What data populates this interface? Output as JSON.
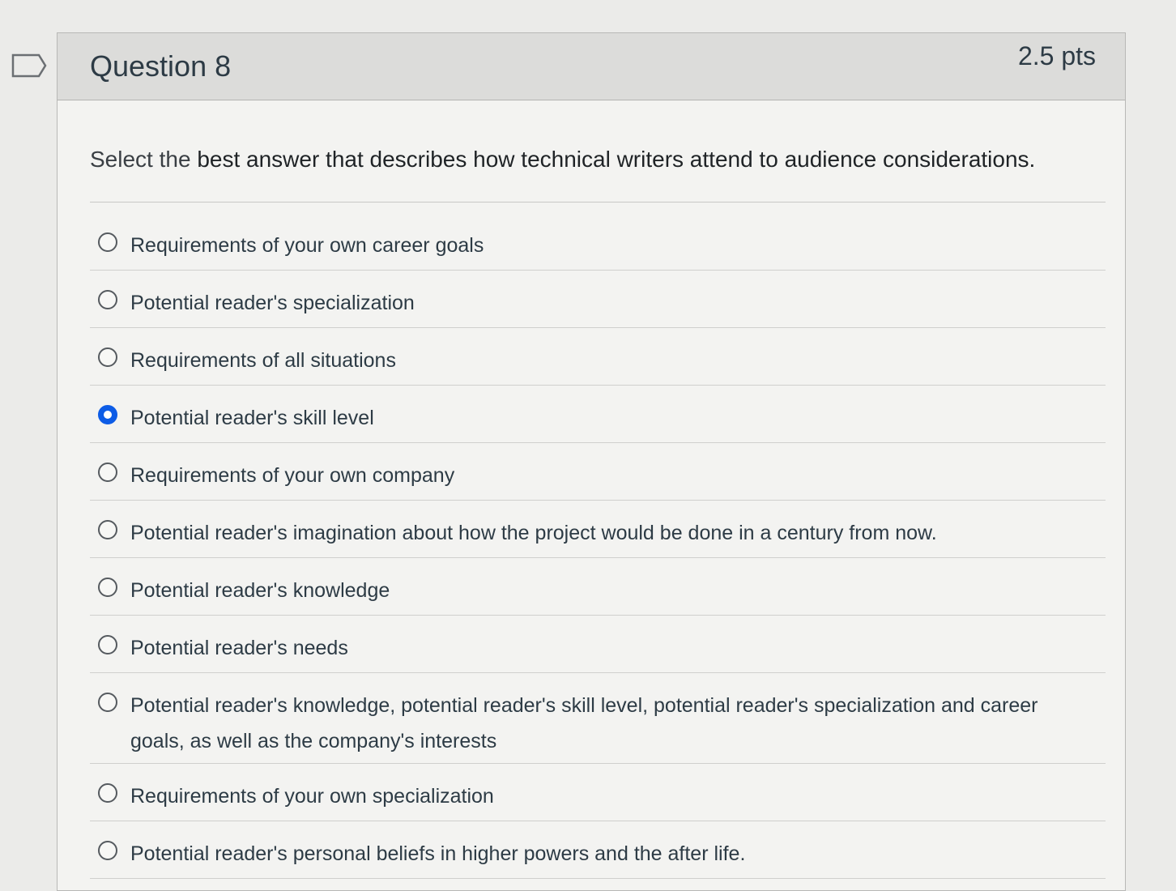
{
  "question": {
    "title": "Question 8",
    "points": "2.5 pts",
    "prompt_lead": "Select  the ",
    "prompt_main": "best answer that describes how technical writers attend to audience considerations."
  },
  "answers": [
    {
      "label": "Requirements of your own career goals",
      "selected": false
    },
    {
      "label": "Potential reader's specialization",
      "selected": false
    },
    {
      "label": "Requirements of all situations",
      "selected": false
    },
    {
      "label": "Potential reader's skill level",
      "selected": true
    },
    {
      "label": "Requirements of your own company",
      "selected": false
    },
    {
      "label": "Potential reader's imagination about how the project would be done in a century from now.",
      "selected": false
    },
    {
      "label": "Potential reader's knowledge",
      "selected": false
    },
    {
      "label": "Potential reader's needs",
      "selected": false
    },
    {
      "label": "Potential reader's knowledge, potential reader's skill level, potential reader's specialization and career goals, as well as the company's interests",
      "selected": false
    },
    {
      "label": "Requirements of your own specialization",
      "selected": false
    },
    {
      "label": "Potential reader's personal beliefs in higher powers and the after life.",
      "selected": false
    }
  ],
  "colors": {
    "selected_radio": "#0d5ce6",
    "header_bg": "#dcdcda"
  },
  "icons": {
    "flag": "bookmark-flag-icon"
  }
}
